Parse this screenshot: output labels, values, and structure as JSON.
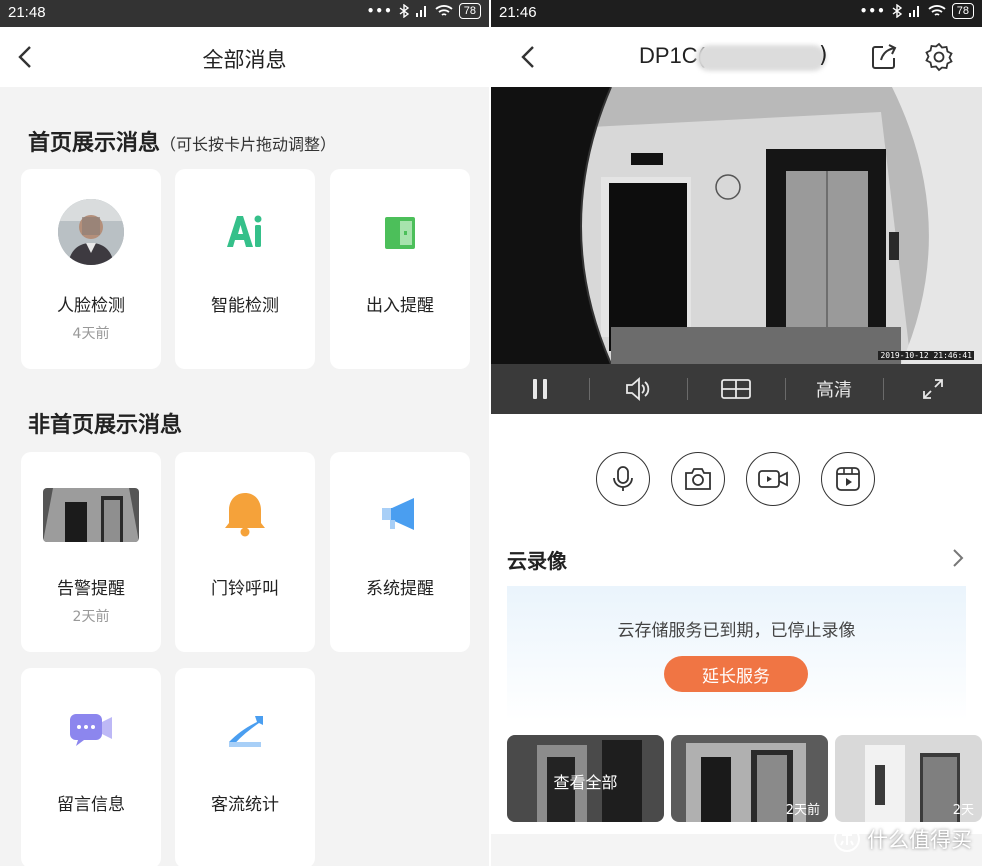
{
  "left": {
    "status": {
      "time": "21:48",
      "battery": "78"
    },
    "header": {
      "title": "全部消息"
    },
    "home_section": {
      "title": "首页展示消息",
      "note": "（可长按卡片拖动调整）"
    },
    "home_cards": [
      {
        "label": "人脸检测",
        "sub": "4天前",
        "icon": "face-avatar"
      },
      {
        "label": "智能检测",
        "sub": "",
        "icon": "ai-icon"
      },
      {
        "label": "出入提醒",
        "sub": "",
        "icon": "door-icon"
      }
    ],
    "other_section": {
      "title": "非首页展示消息"
    },
    "other_cards": [
      {
        "label": "告警提醒",
        "sub": "2天前",
        "icon": "alarm-thumbnail"
      },
      {
        "label": "门铃呼叫",
        "sub": "",
        "icon": "bell-icon"
      },
      {
        "label": "系统提醒",
        "sub": "",
        "icon": "megaphone-icon"
      },
      {
        "label": "留言信息",
        "sub": "",
        "icon": "message-icon"
      },
      {
        "label": "客流统计",
        "sub": "",
        "icon": "trend-icon"
      }
    ]
  },
  "right": {
    "status": {
      "time": "21:46",
      "battery": "78"
    },
    "header": {
      "title_prefix": "DP1C(",
      "title_suffix": ")"
    },
    "video": {
      "timestamp": "2019-10-12 21:46:41"
    },
    "controls": {
      "quality": "高清"
    },
    "cloud": {
      "title": "云录像",
      "expired_text": "云存储服务已到期，已停止录像",
      "extend_button": "延长服务"
    },
    "thumbs": [
      {
        "overlay": "查看全部",
        "age": ""
      },
      {
        "overlay": "",
        "age": "2天前"
      },
      {
        "overlay": "",
        "age": "2天"
      }
    ],
    "watermark": "什么值得买"
  },
  "colors": {
    "accent_orange": "#f07544",
    "ai_green": "#35c08a",
    "door_green": "#4cbf5a",
    "bell_orange": "#f5a23a",
    "msg_purple": "#8c86ee",
    "blue": "#4a9ef0"
  }
}
